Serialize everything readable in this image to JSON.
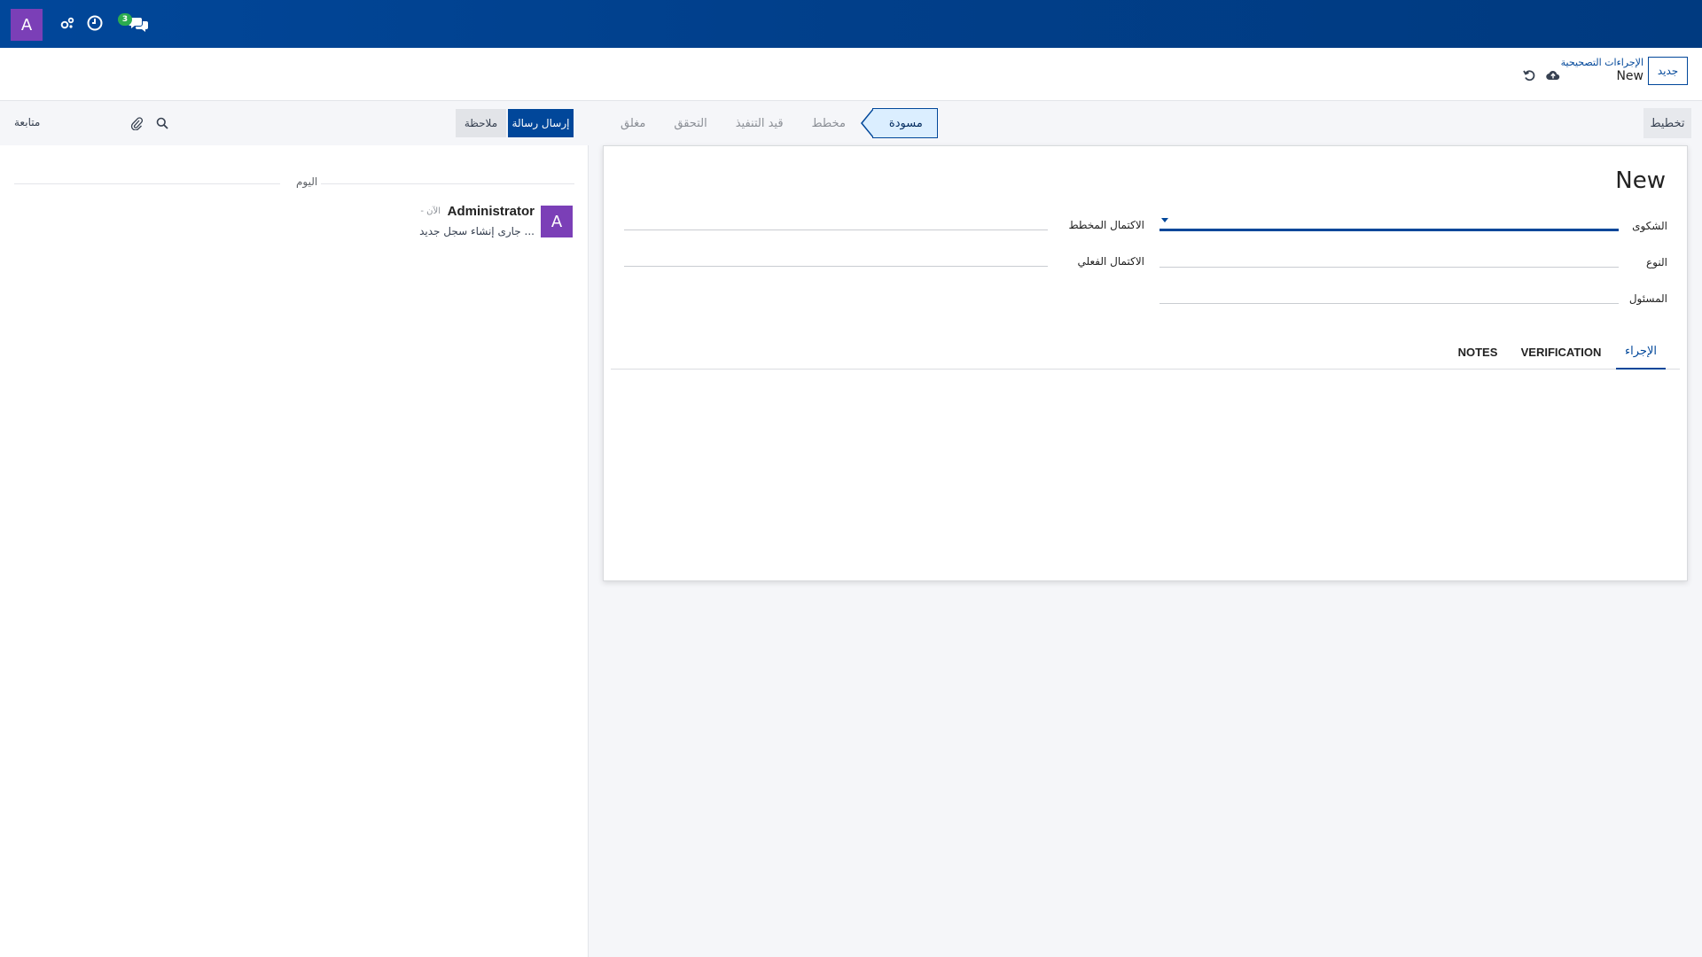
{
  "navbar": {
    "user_initial": "A",
    "messages_badge": "3",
    "icons": [
      "user-avatar",
      "debug-icon",
      "activity-clock-icon",
      "messages-icon"
    ]
  },
  "control_panel": {
    "new_button": "جديد",
    "breadcrumb_parent": "الإجراءات التصحيحية",
    "breadcrumb_current": "New",
    "icons": [
      "save-cloud-icon",
      "discard-undo-icon"
    ]
  },
  "statusbar": {
    "plan_button": "تخطيط",
    "stages": [
      {
        "label": "مسودة",
        "active": true
      },
      {
        "label": "مخطط",
        "active": false
      },
      {
        "label": "قيد التنفيذ",
        "active": false
      },
      {
        "label": "التحقق",
        "active": false
      },
      {
        "label": "مغلق",
        "active": false
      }
    ]
  },
  "form": {
    "title": "New",
    "fields": {
      "complaint": {
        "label": "الشكوى",
        "value": ""
      },
      "type": {
        "label": "النوع",
        "value": ""
      },
      "responsible": {
        "label": "المسئول",
        "value": ""
      },
      "planned_completion": {
        "label": "الاكتمال المخطط",
        "value": ""
      },
      "actual_completion": {
        "label": "الاكتمال الفعلي",
        "value": ""
      }
    },
    "tabs": [
      {
        "label": "الإجراء",
        "active": true
      },
      {
        "label": "VERIFICATION",
        "active": false
      },
      {
        "label": "NOTES",
        "active": false
      }
    ]
  },
  "chatter": {
    "send_message": "إرسال رسالة",
    "log_note": "ملاحظة",
    "follow": "متابعة",
    "date_separator": "اليوم",
    "message": {
      "avatar_initial": "A",
      "author": "Administrator",
      "time": "- الآن",
      "body": "جارى إنشاء سجل جديد ..."
    }
  },
  "colors": {
    "navbar": "#01479a",
    "primary": "#01479a",
    "avatar": "#7b3fb7",
    "badge": "#2cac4f",
    "active_stage_bg": "#dbeeff"
  }
}
